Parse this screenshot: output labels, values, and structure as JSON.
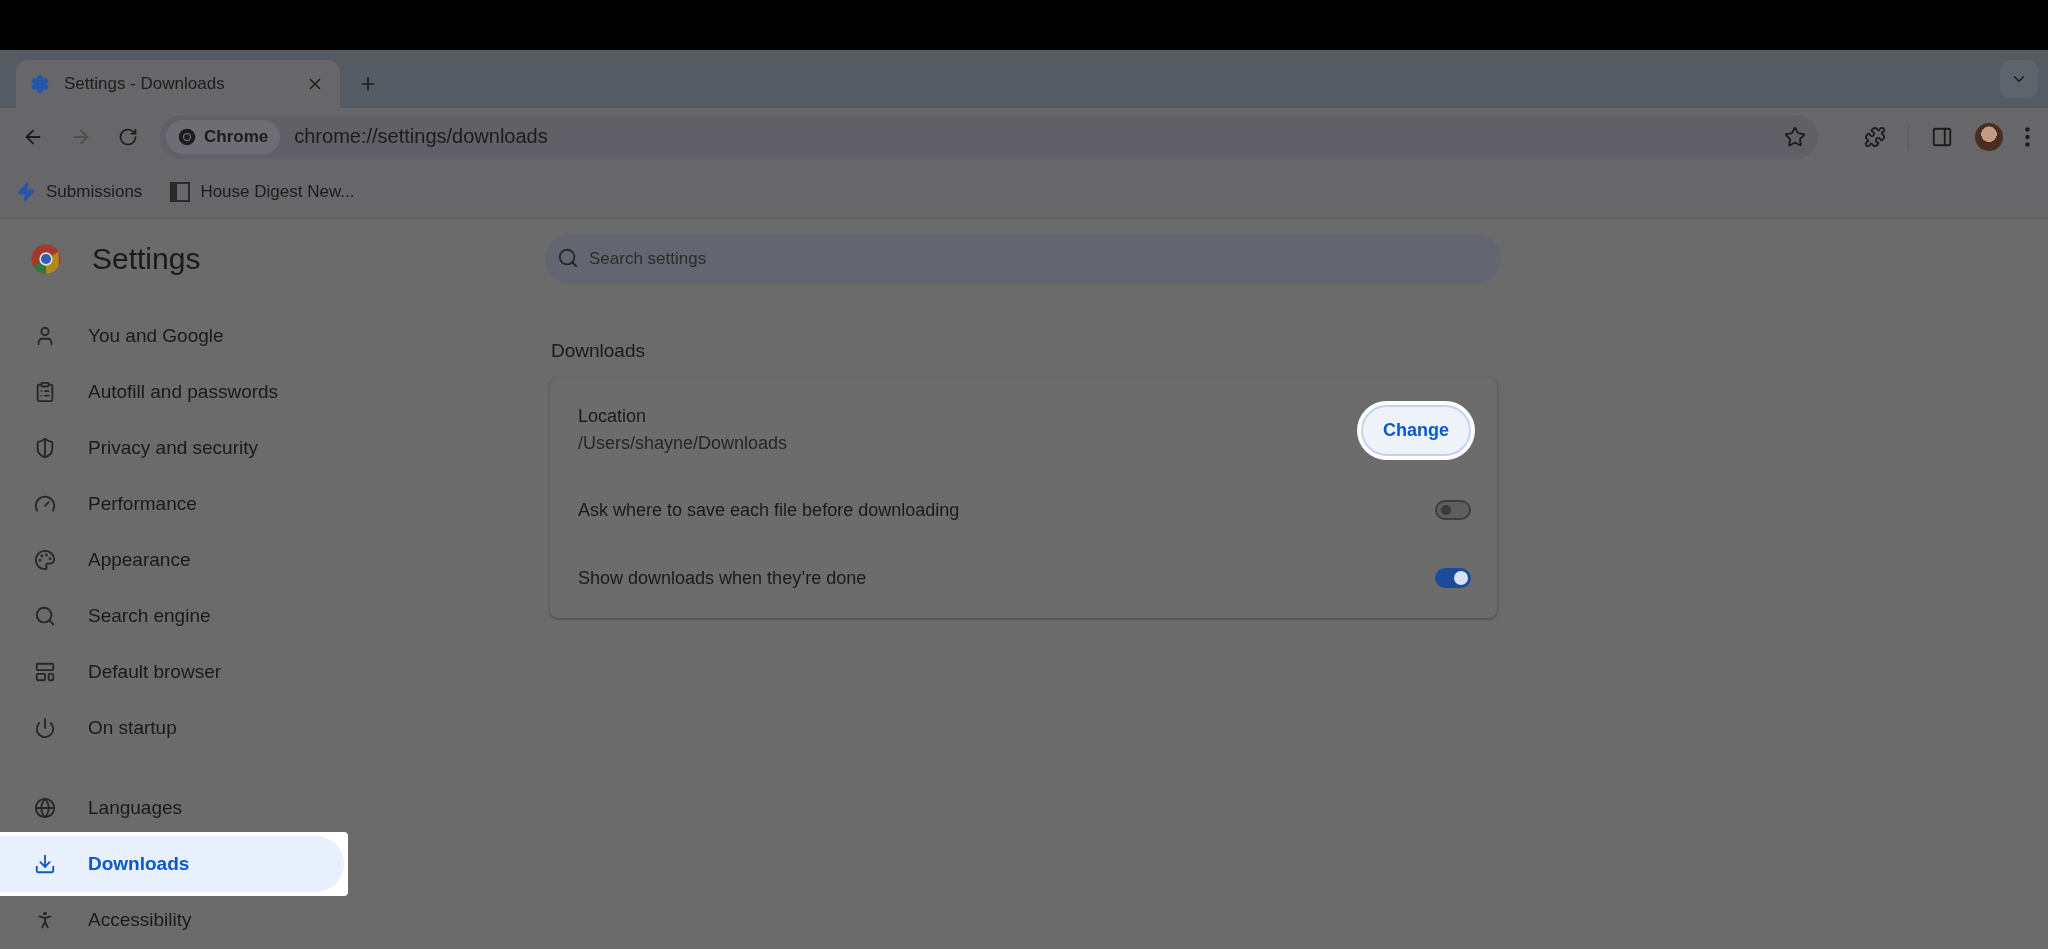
{
  "browser": {
    "tabs": [
      {
        "title": "Settings - Downloads",
        "selected": true
      }
    ],
    "address": {
      "chip": "Chrome",
      "url": "chrome://settings/downloads"
    },
    "bookmarks": [
      {
        "label": "Submissions",
        "kind": "bolt"
      },
      {
        "label": "House Digest New...",
        "kind": "site"
      }
    ]
  },
  "settings": {
    "title": "Settings",
    "search": {
      "placeholder": "Search settings"
    },
    "nav_groups": [
      {
        "items": [
          {
            "label": "You and Google",
            "kind": "person",
            "selected": false
          },
          {
            "label": "Autofill and passwords",
            "kind": "clipboard",
            "selected": false
          },
          {
            "label": "Privacy and security",
            "kind": "shield",
            "selected": false
          },
          {
            "label": "Performance",
            "kind": "gauge",
            "selected": false
          },
          {
            "label": "Appearance",
            "kind": "palette",
            "selected": false
          },
          {
            "label": "Search engine",
            "kind": "search",
            "selected": false
          },
          {
            "label": "Default browser",
            "kind": "browser",
            "selected": false
          },
          {
            "label": "On startup",
            "kind": "power",
            "selected": false
          }
        ]
      },
      {
        "items": [
          {
            "label": "Languages",
            "kind": "globe",
            "selected": false
          },
          {
            "label": "Downloads",
            "kind": "download",
            "selected": true
          },
          {
            "label": "Accessibility",
            "kind": "accessibility",
            "selected": false
          }
        ]
      }
    ],
    "section": {
      "title": "Downloads",
      "rows": [
        {
          "kind": "location",
          "label": "Location",
          "value": "/Users/shayne/Downloads",
          "button": "Change",
          "highlighted": true
        },
        {
          "kind": "toggle",
          "label": "Ask where to save each file before downloading",
          "on": false
        },
        {
          "kind": "toggle",
          "label": "Show downloads when they’re done",
          "on": true
        }
      ]
    }
  }
}
